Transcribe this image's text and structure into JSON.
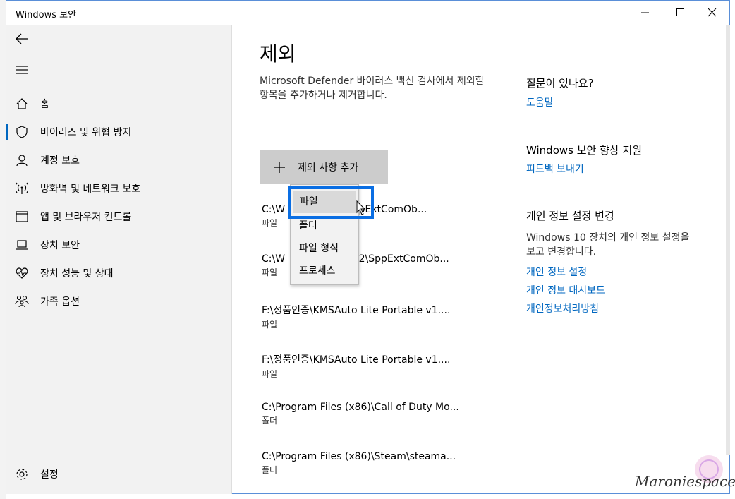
{
  "window": {
    "title": "Windows 보안"
  },
  "sidebar": {
    "items": [
      {
        "label": "홈",
        "icon": "home-icon"
      },
      {
        "label": "바이러스 및 위협 방지",
        "icon": "shield-icon"
      },
      {
        "label": "계정 보호",
        "icon": "person-icon"
      },
      {
        "label": "방화벽 및 네트워크 보호",
        "icon": "antenna-icon"
      },
      {
        "label": "앱 및 브라우저 컨트롤",
        "icon": "browser-window-icon"
      },
      {
        "label": "장치 보안",
        "icon": "laptop-icon"
      },
      {
        "label": "장치 성능 및 상태",
        "icon": "heart-pulse-icon"
      },
      {
        "label": "가족 옵션",
        "icon": "family-icon"
      }
    ],
    "settings": {
      "label": "설정",
      "icon": "gear-icon"
    }
  },
  "main": {
    "title": "제외",
    "description": "Microsoft Defender 바이러스 백신 검사에서 제외할 항목을 추가하거나 제거합니다.",
    "add_button": "제외 사항 추가",
    "exclusions": [
      {
        "path": "C:\\W",
        "path_tail": "\\SppExtComOb...",
        "type": "파일"
      },
      {
        "path": "C:\\W",
        "path_tail": "m32\\SppExtComOb...",
        "type": "파일"
      },
      {
        "path": "F:\\정품인증\\KMSAuto Lite Portable v1....",
        "type": "파일"
      },
      {
        "path": "F:\\정품인증\\KMSAuto Lite Portable v1....",
        "type": "파일"
      },
      {
        "path": "C:\\Program Files (x86)\\Call of Duty Mo...",
        "type": "폴더"
      },
      {
        "path": "C:\\Program Files (x86)\\Steam\\steama...",
        "type": "폴더"
      }
    ],
    "dropdown": [
      "파일",
      "폴더",
      "파일 형식",
      "프로세스"
    ]
  },
  "right": {
    "help_heading": "질문이 있나요?",
    "help_link": "도움말",
    "improve_heading": "Windows 보안 향상 지원",
    "feedback_link": "피드백 보내기",
    "privacy_heading": "개인 정보 설정 변경",
    "privacy_desc": "Windows 10 장치의 개인 정보 설정을 보고 변경합니다.",
    "privacy_links": [
      "개인 정보 설정",
      "개인 정보 대시보드",
      "개인정보처리방침"
    ]
  },
  "watermark": "Maroniespace",
  "colors": {
    "accent": "#0067c0",
    "highlight_border": "#0a6ee3",
    "sidebar_bg": "#f2f2f2",
    "button_bg": "#cccccc"
  }
}
